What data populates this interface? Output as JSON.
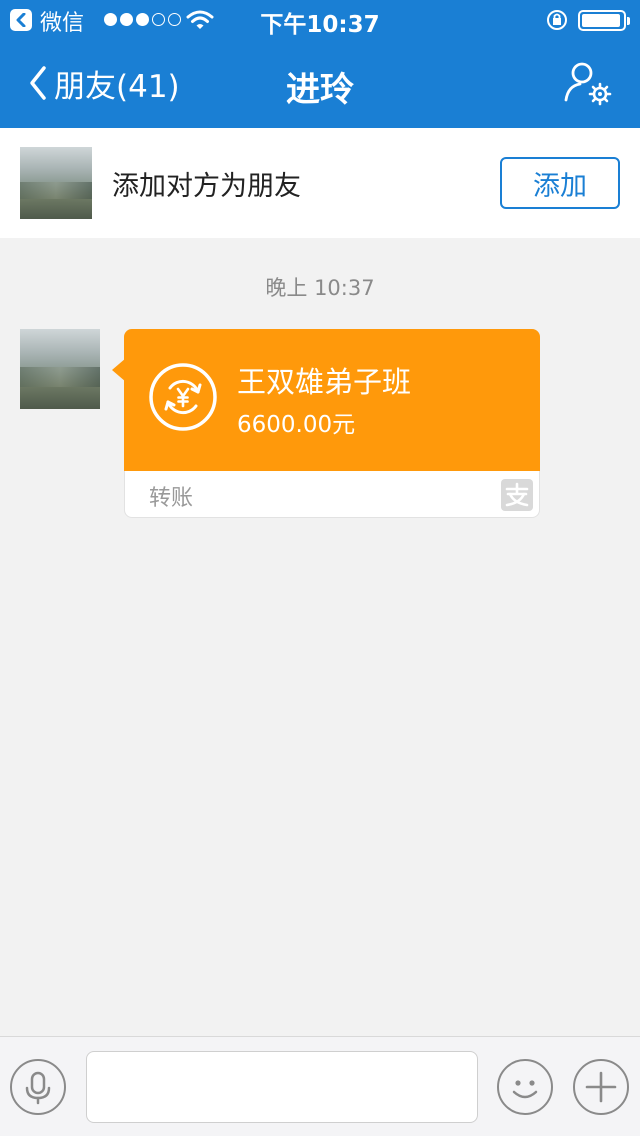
{
  "status_bar": {
    "back_app": "微信",
    "time": "下午10:37"
  },
  "nav": {
    "back_label": "朋友(41)",
    "title": "进玲"
  },
  "add_friend_banner": {
    "text": "添加对方为朋友",
    "button_label": "添加"
  },
  "chat": {
    "timestamp": "晚上 10:37",
    "transfer_card": {
      "name": "王双雄弟子班",
      "amount": "6600.00元",
      "type_label": "转账",
      "color": "#ff990b"
    }
  },
  "colors": {
    "nav_bg": "#1a7fd4",
    "chat_bg": "#f2f2f2",
    "accent": "#1a7fd4"
  },
  "icons": {
    "status_back": "chevron-left-icon",
    "wifi": "wifi-icon",
    "rotation_lock": "rotation-lock-icon",
    "battery": "battery-icon",
    "profile_settings": "profile-settings-icon",
    "coin": "yuan-transfer-icon",
    "alipay": "alipay-icon",
    "voice": "microphone-icon",
    "emoji": "emoji-icon",
    "plus": "plus-icon"
  }
}
